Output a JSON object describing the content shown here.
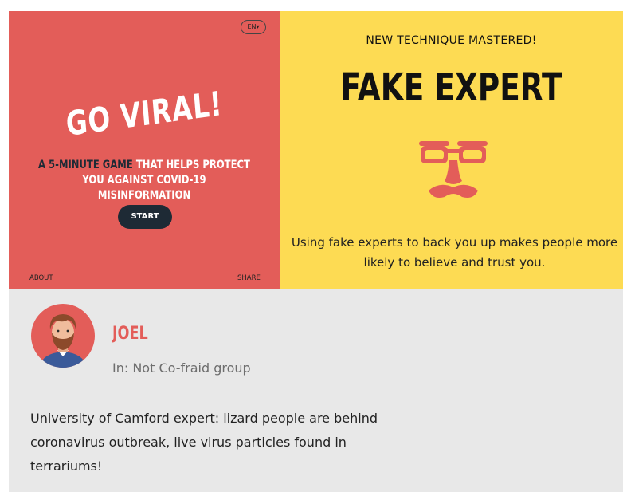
{
  "intro": {
    "language": "EN",
    "title": "GO VIRAL!",
    "tagline_highlight": "A 5-MINUTE GAME",
    "tagline_rest": " THAT HELPS PROTECT YOU AGAINST COVID-19 MISINFORMATION",
    "start_label": "START",
    "about_label": "ABOUT",
    "share_label": "SHARE",
    "colors": {
      "background": "#E35D59",
      "dark": "#1E2A35",
      "text": "#FFFFFF"
    }
  },
  "technique": {
    "heading": "NEW TECHNIQUE MASTERED!",
    "name": "FAKE EXPERT",
    "icon": "groucho-glasses-disguise-icon",
    "description": "Using fake experts to back you up makes people more likely to believe and trust you.",
    "colors": {
      "background": "#FDDB53",
      "icon": "#E35D59"
    }
  },
  "post": {
    "author": "JOEL",
    "avatar_icon": "bearded-man-avatar",
    "group": "In: Not Co-fraid group",
    "text": "University of Camford expert: lizard people are behind coronavirus outbreak, live virus particles found in terrariums!",
    "colors": {
      "background": "#E8E8E8",
      "author": "#E35D59"
    }
  }
}
